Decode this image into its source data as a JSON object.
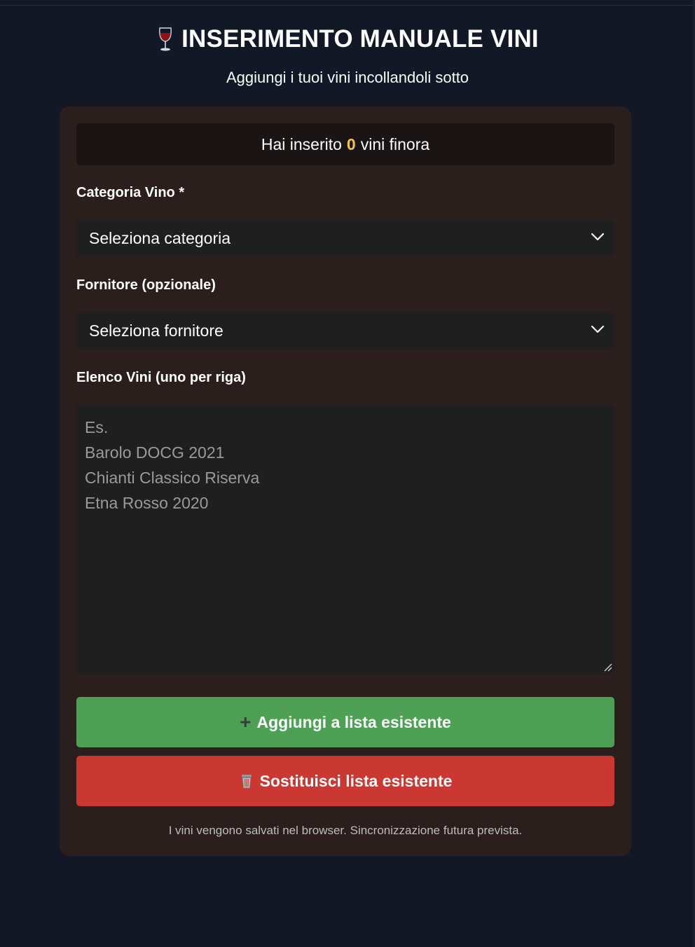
{
  "header": {
    "title_icon": "wine-glass-icon",
    "title": "INSERIMENTO MANUALE VINI",
    "subtitle": "Aggiungi i tuoi vini incollandoli sotto"
  },
  "counter": {
    "prefix": "Hai inserito",
    "count": "0",
    "suffix": "vini finora",
    "accent_color": "#f5c542"
  },
  "form": {
    "category_label": "Categoria Vino *",
    "category_selected": "Seleziona categoria",
    "supplier_label": "Fornitore (opzionale)",
    "supplier_selected": "Seleziona fornitore",
    "wines_label": "Elenco Vini (uno per riga)",
    "wines_value": "",
    "wines_placeholder_lines": [
      "Es.",
      "Barolo DOCG 2021",
      "Chianti Classico Riserva",
      "Etna Rosso 2020"
    ]
  },
  "buttons": {
    "add_icon": "plus-icon",
    "add_label": "Aggiungi a lista esistente",
    "add_color": "#4ea154",
    "replace_icon": "trash-icon",
    "replace_label": "Sostituisci lista esistente",
    "replace_color": "#cb3731"
  },
  "footnote": "I vini vengono salvati nel browser. Sincronizzazione futura prevista."
}
